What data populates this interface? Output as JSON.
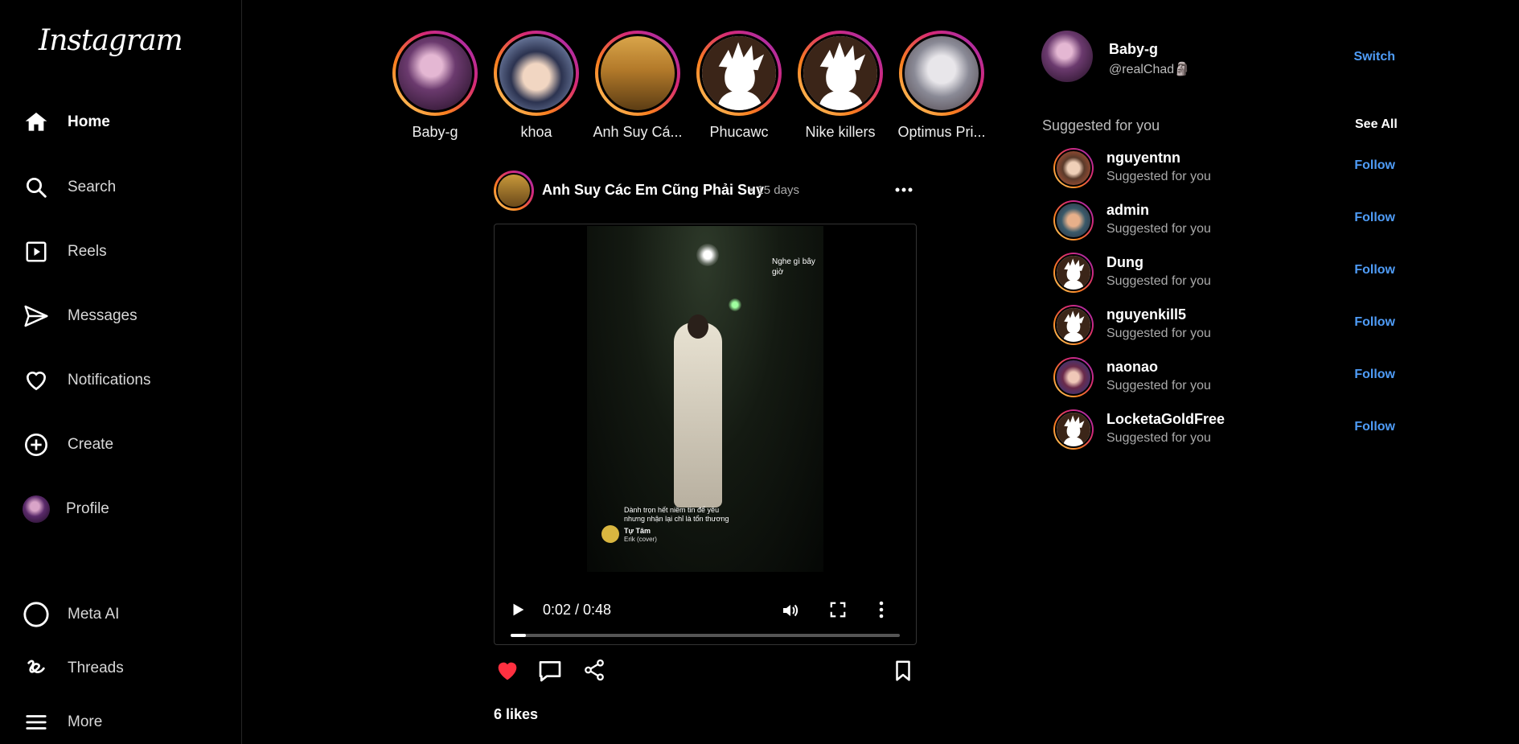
{
  "app": {
    "logo": "Instagram"
  },
  "colors": {
    "accent_link": "#4f9cf7",
    "like_red": "#ff3040"
  },
  "nav": {
    "home": "Home",
    "search": "Search",
    "reels": "Reels",
    "messages": "Messages",
    "notifications": "Notifications",
    "create": "Create",
    "profile": "Profile",
    "meta_ai": "Meta AI",
    "threads": "Threads",
    "more": "More"
  },
  "stories": [
    {
      "name": "Baby-g"
    },
    {
      "name": "khoa"
    },
    {
      "name": "Anh Suy Cá..."
    },
    {
      "name": "Phucawc"
    },
    {
      "name": "Nike killers"
    },
    {
      "name": "Optimus Pri..."
    }
  ],
  "post": {
    "author": "Anh Suy Các Em Cũng Phải Suy",
    "age": "• 15 days",
    "video": {
      "overlay_top": "Nghe gì bây giờ",
      "lyric_line1": "Dành trọn hết niềm tin để yêu",
      "lyric_line2": "nhưng nhận lại chỉ là tổn thương",
      "song_title": "Tự Tâm",
      "song_artist": "Erik (cover)",
      "time": "0:02 / 0:48",
      "progress": 0.04
    },
    "likes": "6 likes",
    "liked": true
  },
  "me": {
    "name": "Baby-g",
    "handle": "@realChad🗿",
    "switch_label": "Switch"
  },
  "suggestions": {
    "title": "Suggested for you",
    "see_all": "See All",
    "follow_label": "Follow",
    "items": [
      {
        "username": "nguyentnn",
        "sub": "Suggested for you"
      },
      {
        "username": "admin",
        "sub": "Suggested for you"
      },
      {
        "username": "Dung",
        "sub": "Suggested for you"
      },
      {
        "username": "nguyenkill5",
        "sub": "Suggested for you"
      },
      {
        "username": "naonao",
        "sub": "Suggested for you"
      },
      {
        "username": "LocketaGoldFree",
        "sub": "Suggested for you"
      }
    ]
  }
}
